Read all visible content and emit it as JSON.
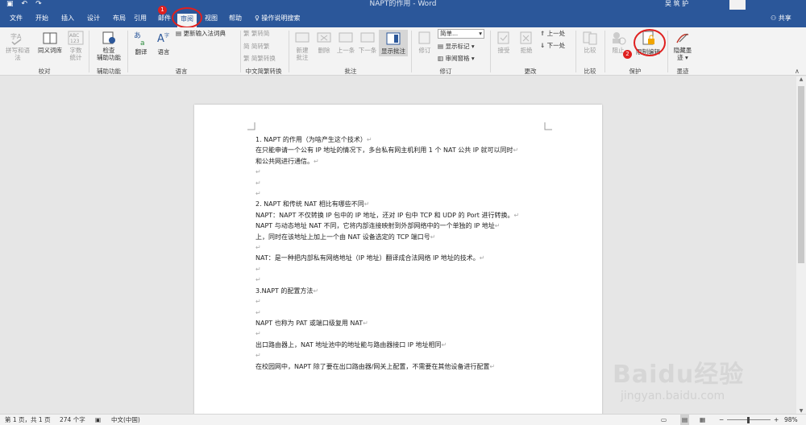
{
  "window": {
    "title": "NAPT的作用 - Word",
    "user": "吴 筑 护"
  },
  "qat": {
    "save_icon": "save-icon",
    "undo_icon": "undo-icon",
    "redo_icon": "redo-icon"
  },
  "tabs": [
    "文件",
    "开始",
    "插入",
    "设计",
    "布局",
    "引用",
    "邮件",
    "审阅",
    "视图",
    "帮助"
  ],
  "tellme": "操作说明搜索",
  "share": "共享",
  "ribbon": {
    "proofing": {
      "spell": "拼写和语法",
      "thesaurus": "同义词库",
      "wordcount_l1": "字数",
      "wordcount_l2": "统计",
      "group": "校对",
      "abc": "ABC",
      "num": "123"
    },
    "accessibility": {
      "check_l1": "检查",
      "check_l2": "辅助功能",
      "group": "辅助功能"
    },
    "language": {
      "translate": "翻译",
      "language": "语言",
      "ime": "更新输入法词典",
      "group": "语言"
    },
    "chinese": {
      "to_trad": "繁转简",
      "to_simp": "简转繁",
      "convert": "简繁转换",
      "group": "中文简繁转换"
    },
    "comments": {
      "new": "新建",
      "new2": "批注",
      "delete": "删除",
      "prev": "上一条",
      "next": "下一条",
      "show": "显示批注",
      "group": "批注"
    },
    "tracking": {
      "track": "修订",
      "markup": "简单...",
      "show_markup": "显示标记",
      "pane": "审阅窗格",
      "group": "修订"
    },
    "changes": {
      "accept": "接受",
      "reject": "拒绝",
      "prev": "上一处",
      "next": "下一处",
      "group": "更改"
    },
    "compare": {
      "compare": "比较",
      "group": "比较"
    },
    "protect": {
      "block": "阻止",
      "restrict": "限制编辑",
      "group": "保护"
    },
    "ink": {
      "hide_l1": "隐藏墨",
      "hide_l2": "迹",
      "group": "墨迹"
    }
  },
  "annotations": {
    "badge1": "1",
    "badge2": "2"
  },
  "document": {
    "lines": [
      "1.   NAPT 的作用（为啥产生这个技术）",
      "在只能申请一个公有 IP 地址的情况下，多台私有网主机利用 1 个 NAT 公共 IP 就可以同时",
      "和公共网进行通信。",
      "",
      "",
      "",
      "2.   NAPT 和传统 NAT 相比有哪些不同",
      "NAPT：NAPT 不仅转换 IP 包中的 IP 地址，还对 IP 包中 TCP 和 UDP 的 Port 进行转换。",
      "        NAPT 与动态地址 NAT 不同，它将内部连接映射到外部网络中的一个单独的 IP 地址",
      "上，同时在该地址上加上一个由 NAT 设备选定的 TCP 端口号",
      "",
      "NAT：是一种把内部私有网络地址（IP 地址）翻译成合法网络 IP 地址的技术。",
      "",
      "",
      "3.NAPT 的配置方法",
      "",
      "",
      "NAPT 也称为 PAT 或端口级复用 NAT",
      "",
      "出口路由器上，NAT 地址池中的地址能与路由器接口 IP 地址相同",
      "",
      "在校园网中，NAPT 除了要在出口路由器/网关上配置，不需要在其他设备进行配置"
    ],
    "para_mark": "↵"
  },
  "status": {
    "page": "第 1 页，共 1 页",
    "words": "274 个字",
    "lang": "中文(中国)",
    "zoom": "98%"
  },
  "watermark": {
    "brand": "Baidu经验",
    "url": "jingyan.baidu.com"
  },
  "colors": {
    "word_blue": "#2b579a",
    "highlight_red": "#e0201f"
  }
}
